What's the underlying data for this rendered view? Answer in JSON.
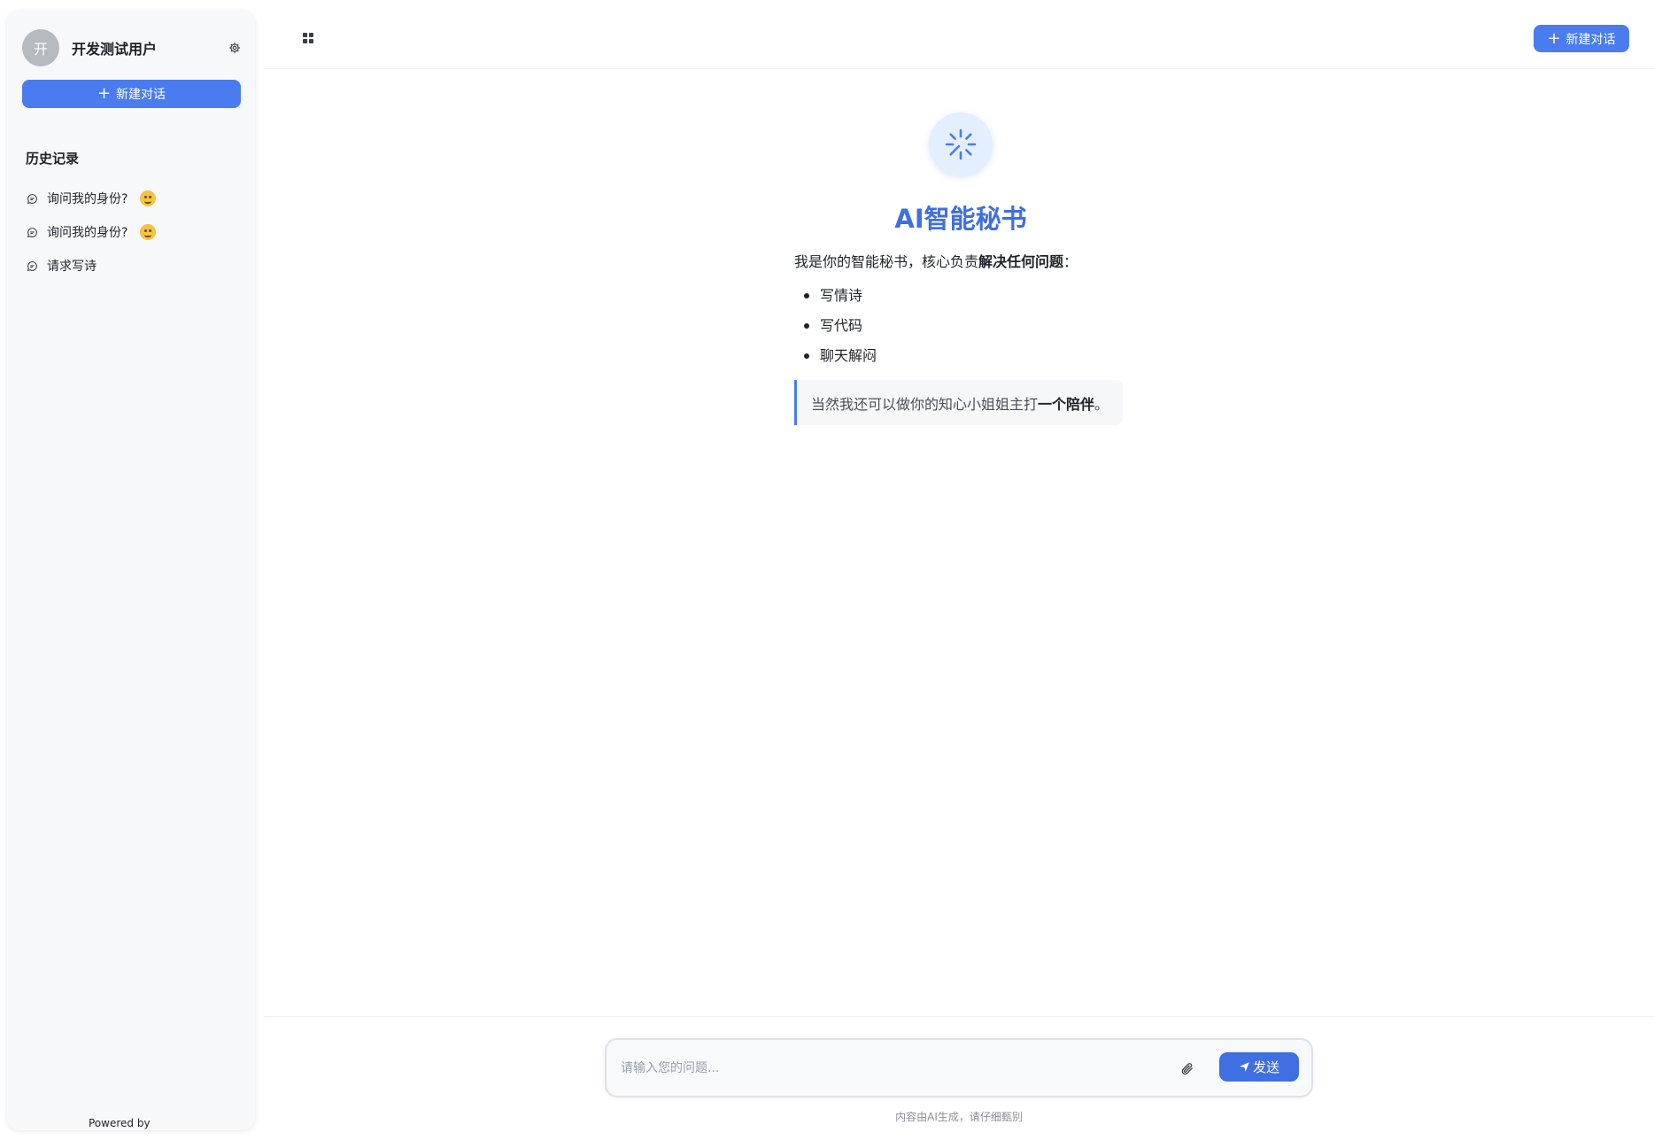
{
  "sidebar": {
    "user": {
      "avatar_text": "开",
      "name": "开发测试用户"
    },
    "new_chat_label": "新建对话",
    "history_title": "历史记录",
    "history_items": [
      {
        "label": "询问我的身份?",
        "emoji": "thinking-face"
      },
      {
        "label": "询问我的身份?",
        "emoji": "thinking-face"
      },
      {
        "label": "请求写诗"
      }
    ],
    "powered_by": "Powered by"
  },
  "topbar": {
    "new_chat_label": "新建对话"
  },
  "main": {
    "app_title": "AI智能秘书",
    "intro_prefix": "我是你的智能秘书，核心负责",
    "intro_bold": "解决任何问题",
    "intro_suffix": "：",
    "features": [
      "写情诗",
      "写代码",
      "聊天解闷"
    ],
    "quote_prefix": "当然我还可以做你的知心小姐姐主打",
    "quote_bold": "一个陪伴",
    "quote_suffix": "。"
  },
  "composer": {
    "placeholder": "请输入您的问题...",
    "value": "",
    "send_label": "发送",
    "disclaimer": "内容由AI生成，请仔细甄别"
  },
  "colors": {
    "accent": "#4a7cf0",
    "title": "#3f6fe0",
    "sidebar_bg": "#f7f8fa"
  }
}
